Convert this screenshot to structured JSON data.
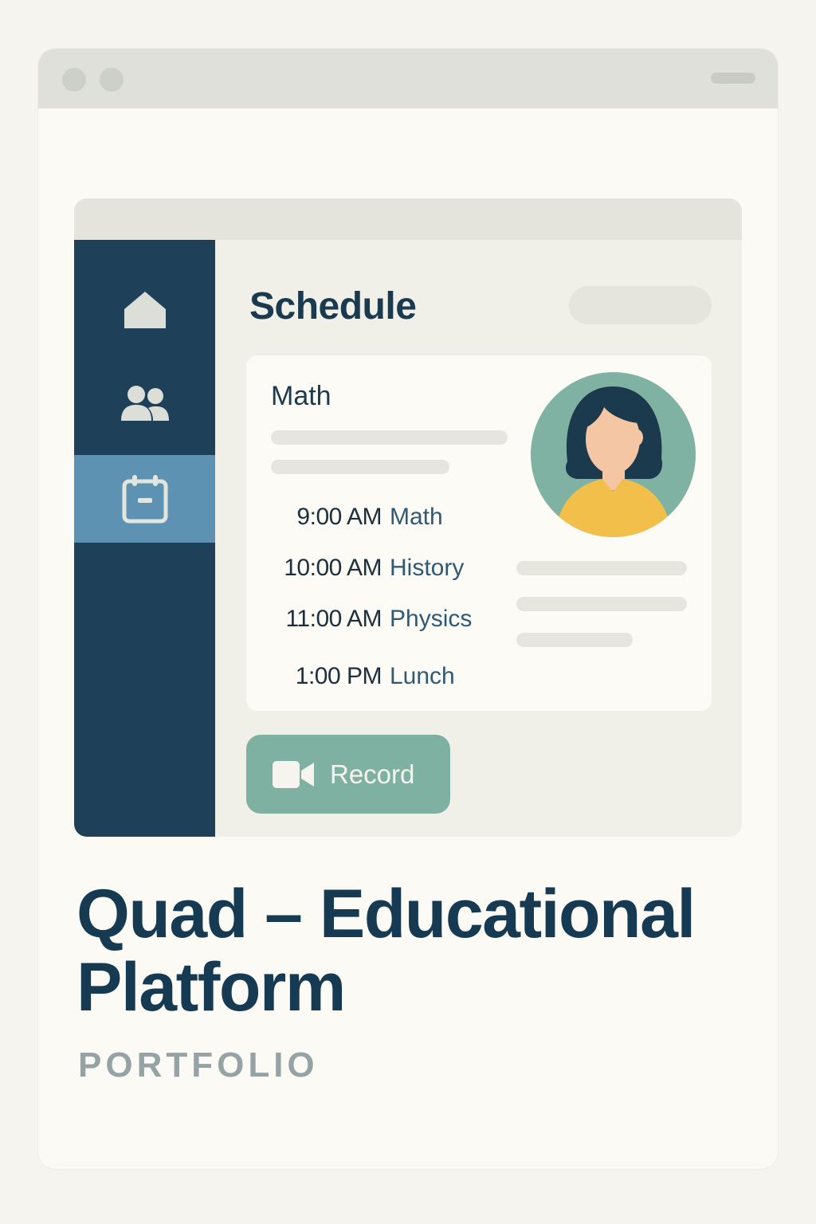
{
  "colors": {
    "background": "#f6f4ee",
    "sidebar": "#1e4159",
    "sidebar_active": "#5e92b2",
    "accent_teal": "#7fb1a3",
    "avatar_shirt": "#f2c04a",
    "title_text": "#163a52",
    "subtitle_text": "#95a3a4"
  },
  "sidebar": {
    "items": [
      {
        "icon": "home-icon",
        "active": false
      },
      {
        "icon": "users-icon",
        "active": false
      },
      {
        "icon": "calendar-icon",
        "active": true
      }
    ]
  },
  "main": {
    "page_title": "Schedule",
    "card": {
      "title": "Math",
      "schedule": [
        {
          "time": "9:00 AM",
          "subject": "Math"
        },
        {
          "time": "10:00 AM",
          "subject": "History"
        },
        {
          "time": "11:00 AM",
          "subject": "Physics"
        },
        {
          "time": "1:00 PM",
          "subject": "Lunch"
        }
      ],
      "avatar_icon": "student-avatar-icon"
    },
    "record_button": {
      "label": "Record",
      "icon": "video-camera-icon"
    }
  },
  "hero": {
    "title_line1": "Quad – Educational",
    "title_line2": "Platform",
    "subtitle": "PORTFOLIO"
  }
}
